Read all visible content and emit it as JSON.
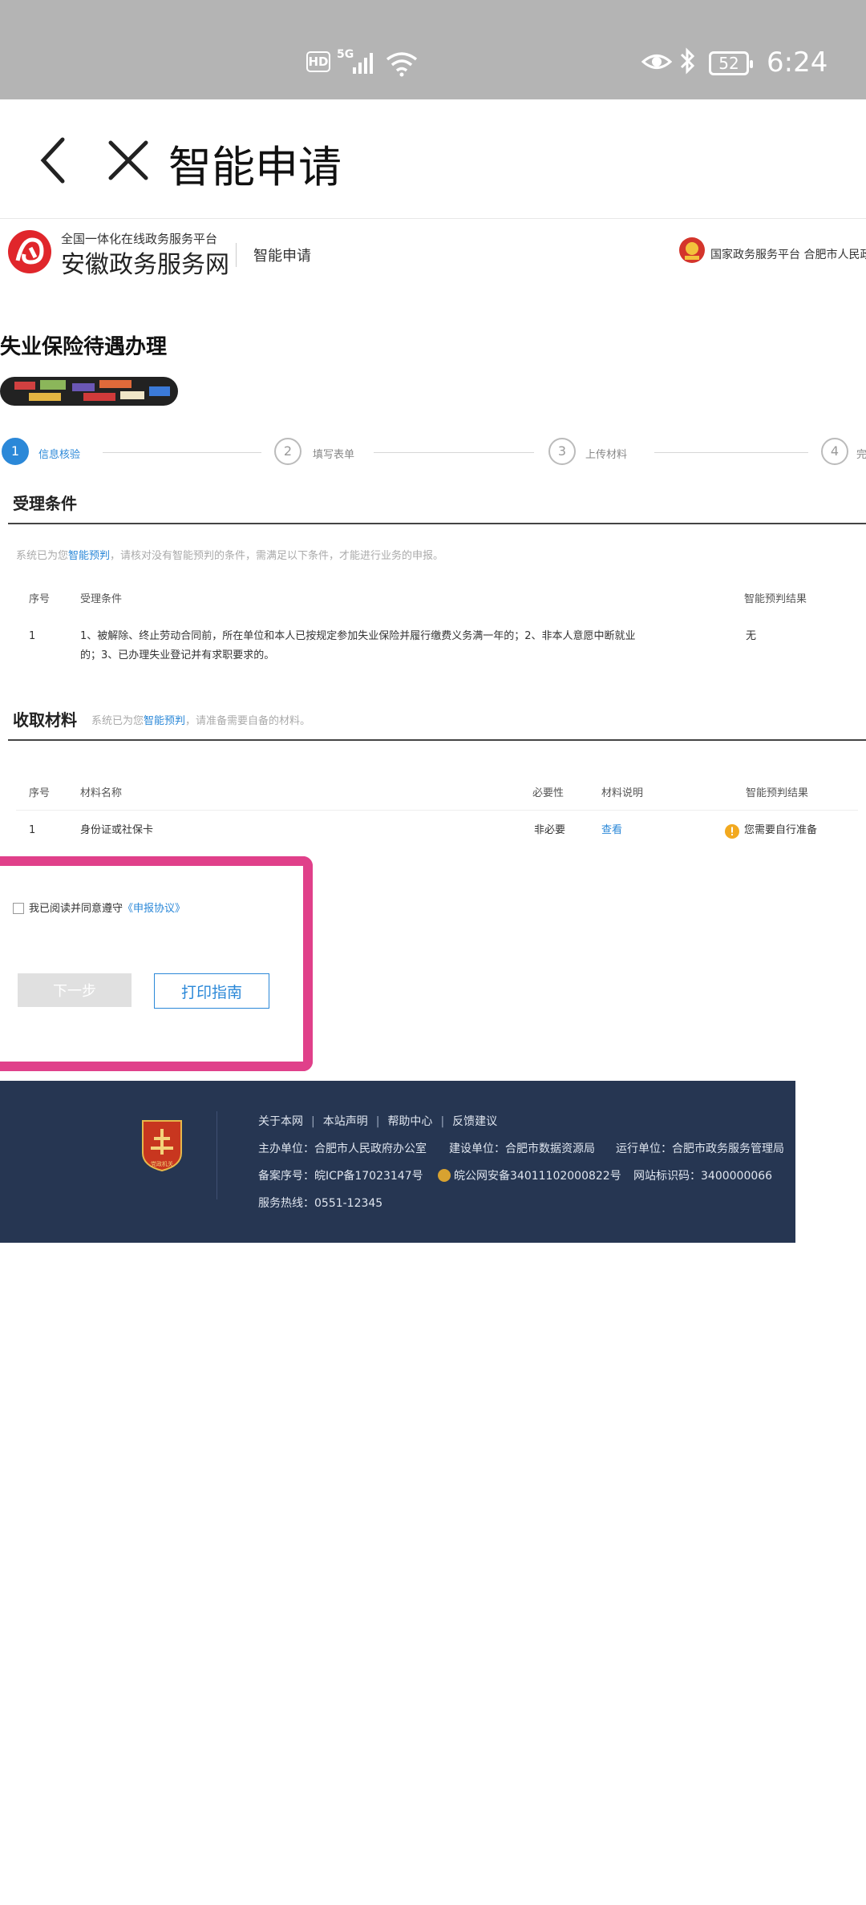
{
  "status_bar": {
    "hd": "HD",
    "network": "5G",
    "battery": "52",
    "time": "6:24"
  },
  "app_bar": {
    "title": "智能申请"
  },
  "site_header": {
    "platform_subtitle": "全国一体化在线政务服务平台",
    "site_name": "安徽政务服务网",
    "service_label": "智能申请",
    "right_text": "国家政务服务平台 合肥市人民政"
  },
  "page": {
    "title": "失业保险待遇办理"
  },
  "steps": [
    {
      "number": "1",
      "label": "信息核验"
    },
    {
      "number": "2",
      "label": "填写表单"
    },
    {
      "number": "3",
      "label": "上传材料"
    },
    {
      "number": "4",
      "label": "完"
    }
  ],
  "conditions": {
    "title": "受理条件",
    "hint_prefix": "系统已为您",
    "hint_link": "智能预判",
    "hint_suffix": "，请核对没有智能预判的条件，需满足以下条件，才能进行业务的申报。",
    "headers": [
      "序号",
      "受理条件",
      "智能预判结果"
    ],
    "rows": [
      {
        "index": "1",
        "text": "1、被解除、终止劳动合同前，所在单位和本人已按规定参加失业保险并履行缴费义务满一年的；2、非本人意愿中断就业的；3、已办理失业登记并有求职要求的。",
        "result": "无"
      }
    ]
  },
  "materials": {
    "title": "收取材料",
    "hint_prefix": "系统已为您",
    "hint_link": "智能预判",
    "hint_suffix": "，请准备需要自备的材料。",
    "headers": [
      "序号",
      "材料名称",
      "必要性",
      "材料说明",
      "智能预判结果"
    ],
    "rows": [
      {
        "index": "1",
        "name": "身份证或社保卡",
        "necessity": "非必要",
        "desc_link": "查看",
        "result": "您需要自行准备"
      }
    ]
  },
  "agreement": {
    "text": "我已阅读并同意遵守",
    "link": "《申报协议》"
  },
  "buttons": {
    "next": "下一步",
    "print": "打印指南"
  },
  "footer": {
    "links": [
      "关于本网",
      "本站声明",
      "帮助中心",
      "反馈建议"
    ],
    "host": "主办单位：合肥市人民政府办公室",
    "builder": "建设单位：合肥市数据资源局",
    "operator": "运行单位：合肥市政务服务管理局",
    "icp": "备案序号：皖ICP备17023147号",
    "police": "皖公网安备34011102000822号",
    "site_id": "网站标识码：3400000066",
    "hotline": "服务热线：0551-12345",
    "logo_caption": "党政机关"
  },
  "colors": {
    "accent": "#2b88d8",
    "highlight": "#e0408a",
    "footer_bg": "#263652"
  }
}
